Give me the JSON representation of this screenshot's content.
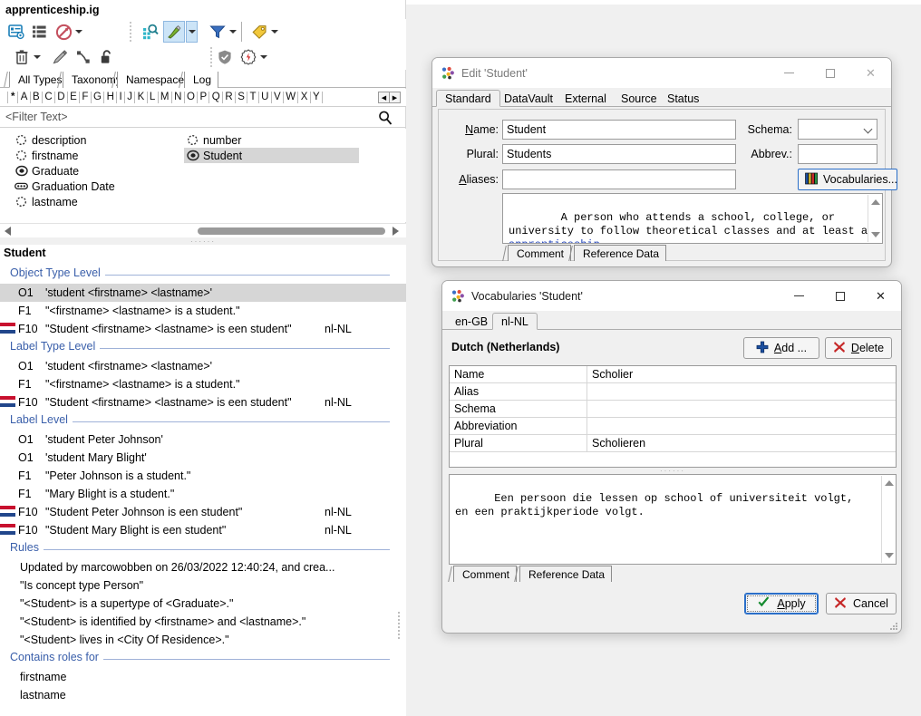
{
  "app": {
    "title": "apprenticeship.ig",
    "toolbar_row1": [
      {
        "name": "new-type-icon"
      },
      {
        "name": "list-view-icon"
      },
      {
        "name": "no-entry-icon"
      },
      {
        "name": "caret-no-entry-icon"
      },
      {
        "name": "search-grid-icon"
      },
      {
        "name": "highlighter-icon"
      },
      {
        "name": "caret-highlighter-icon"
      },
      {
        "name": "filter-icon"
      },
      {
        "name": "caret-filter-icon"
      },
      {
        "name": "tag-icon"
      },
      {
        "name": "caret-tag-icon"
      }
    ],
    "toolbar_row2": [
      {
        "name": "delete-trash-icon"
      },
      {
        "name": "caret-delete-icon"
      },
      {
        "name": "edit-pencil-icon"
      },
      {
        "name": "relation-icon"
      },
      {
        "name": "unlock-icon"
      },
      {
        "name": "shield-icon"
      },
      {
        "name": "gear-flash-icon"
      },
      {
        "name": "caret-gear-icon"
      }
    ],
    "main_tabs": [
      {
        "label": "All Types",
        "selected": true
      },
      {
        "label": "Taxonomy",
        "selected": false
      },
      {
        "label": "Namespaces",
        "selected": false
      },
      {
        "label": "Log",
        "selected": false
      }
    ],
    "alphabet": [
      "*",
      "A",
      "B",
      "C",
      "D",
      "E",
      "F",
      "G",
      "H",
      "I",
      "J",
      "K",
      "L",
      "M",
      "N",
      "O",
      "P",
      "Q",
      "R",
      "S",
      "T",
      "U",
      "V",
      "W",
      "X",
      "Y"
    ],
    "filter": {
      "placeholder": "<Filter Text>",
      "icon": "search-icon"
    },
    "list_column_1": [
      {
        "label": "description",
        "icon": "dotted-circle-icon",
        "selected": false
      },
      {
        "label": "firstname",
        "icon": "dotted-circle-icon",
        "selected": false
      },
      {
        "label": "Graduate",
        "icon": "object-type-icon",
        "selected": false
      },
      {
        "label": "Graduation Date",
        "icon": "value-type-icon",
        "selected": false
      },
      {
        "label": "lastname",
        "icon": "dotted-circle-icon",
        "selected": false
      }
    ],
    "list_column_2": [
      {
        "label": "number",
        "icon": "dotted-circle-icon",
        "selected": false
      },
      {
        "label": "Student",
        "icon": "object-type-icon",
        "selected": true
      }
    ],
    "details": {
      "title": "Student",
      "sections": [
        {
          "label": "Object Type Level",
          "rows": [
            {
              "code": "O1",
              "text": "'student <firstname> <lastname>'",
              "locale": "",
              "flag": false,
              "selected": true
            },
            {
              "code": "F1",
              "text": "\"<firstname> <lastname> is a student.\"",
              "locale": "",
              "flag": false,
              "selected": false
            },
            {
              "code": "F10",
              "text": "\"Student <firstname> <lastname> is een student\"",
              "locale": "nl-NL",
              "flag": true,
              "selected": false
            }
          ]
        },
        {
          "label": "Label Type Level",
          "rows": [
            {
              "code": "O1",
              "text": "'student <firstname> <lastname>'",
              "locale": "",
              "flag": false,
              "selected": false
            },
            {
              "code": "F1",
              "text": "\"<firstname> <lastname> is a student.\"",
              "locale": "",
              "flag": false,
              "selected": false
            },
            {
              "code": "F10",
              "text": "\"Student <firstname> <lastname> is een student\"",
              "locale": "nl-NL",
              "flag": true,
              "selected": false
            }
          ]
        },
        {
          "label": "Label Level",
          "rows": [
            {
              "code": "O1",
              "text": "'student Peter Johnson'",
              "locale": "",
              "flag": false,
              "selected": false
            },
            {
              "code": "O1",
              "text": "'student Mary Blight'",
              "locale": "",
              "flag": false,
              "selected": false
            },
            {
              "code": "F1",
              "text": "\"Peter Johnson is a student.\"",
              "locale": "",
              "flag": false,
              "selected": false
            },
            {
              "code": "F1",
              "text": "\"Mary Blight is a student.\"",
              "locale": "",
              "flag": false,
              "selected": false
            },
            {
              "code": "F10",
              "text": "\"Student Peter Johnson is een student\"",
              "locale": "nl-NL",
              "flag": true,
              "selected": false
            },
            {
              "code": "F10",
              "text": "\"Student Mary Blight is een student\"",
              "locale": "nl-NL",
              "flag": true,
              "selected": false
            }
          ]
        },
        {
          "label": "Rules",
          "plain_rows": [
            "Updated by marcowobben on 26/03/2022 12:40:24, and crea...",
            "\"Is concept type Person\"",
            "\"<Student> is a supertype of <Graduate>.\"",
            "\"<Student> is identified by <firstname> and <lastname>.\"",
            "\"<Student> lives in <City Of Residence>.\""
          ]
        },
        {
          "label": "Contains roles for",
          "plain_rows": [
            "firstname",
            "lastname"
          ]
        }
      ]
    }
  },
  "edit_dialog": {
    "title": "Edit 'Student'",
    "icon": "app-dots-icon",
    "window_buttons": {
      "minimize": "—",
      "maximize": "□",
      "close": "✕"
    },
    "tabs": [
      {
        "label": "Standard",
        "selected": true
      },
      {
        "label": "DataVault",
        "selected": false
      },
      {
        "label": "External",
        "selected": false
      },
      {
        "label": "Source",
        "selected": false
      },
      {
        "label": "Status",
        "selected": false
      }
    ],
    "fields": {
      "name_label": "Name:",
      "name_value": "Student",
      "plural_label": "Plural:",
      "plural_value": "Students",
      "aliases_label": "Aliases:",
      "aliases_value": "",
      "schema_label": "Schema:",
      "schema_value": "",
      "abbrev_label": "Abbrev.:",
      "abbrev_value": "",
      "vocabularies_button": "Vocabularies...",
      "vocabularies_icon": "books-icon"
    },
    "comment_text_before": "A person who attends a school, college, or university to follow theoretical classes and at least an ",
    "comment_link": "apprenticeship",
    "comment_text_after": ".",
    "sub_tabs": [
      {
        "label": "Comment",
        "selected": true
      },
      {
        "label": "Reference Data",
        "selected": false
      }
    ]
  },
  "vocab_dialog": {
    "title": "Vocabularies 'Student'",
    "icon": "app-dots-icon",
    "window_buttons": {
      "minimize": "—",
      "maximize": "□",
      "close": "✕"
    },
    "tabs": [
      {
        "label": "en-GB",
        "selected": false
      },
      {
        "label": "nl-NL",
        "selected": true
      }
    ],
    "locale_heading": "Dutch (Netherlands)",
    "add_button": "Add ...",
    "add_icon": "plus-icon",
    "delete_button": "Delete",
    "delete_icon": "cross-icon",
    "table": [
      {
        "key": "Name",
        "value": "Scholier"
      },
      {
        "key": "Alias",
        "value": ""
      },
      {
        "key": "Schema",
        "value": ""
      },
      {
        "key": "Abbreviation",
        "value": ""
      },
      {
        "key": "Plural",
        "value": "Scholieren"
      }
    ],
    "comment_text": "Een persoon die lessen op school of universiteit volgt,\nen een praktijkperiode volgt.",
    "sub_tabs": [
      {
        "label": "Comment",
        "selected": true
      },
      {
        "label": "Reference Data",
        "selected": false
      }
    ],
    "apply_button": "Apply",
    "apply_icon": "check-icon",
    "cancel_button": "Cancel",
    "cancel_icon": "cross-icon"
  },
  "colors": {
    "accent_blue": "#2a6fc9",
    "section_blue": "#3a5faa",
    "selection_gray": "#d6d6d6",
    "window_bg": "#f0f0f0"
  }
}
